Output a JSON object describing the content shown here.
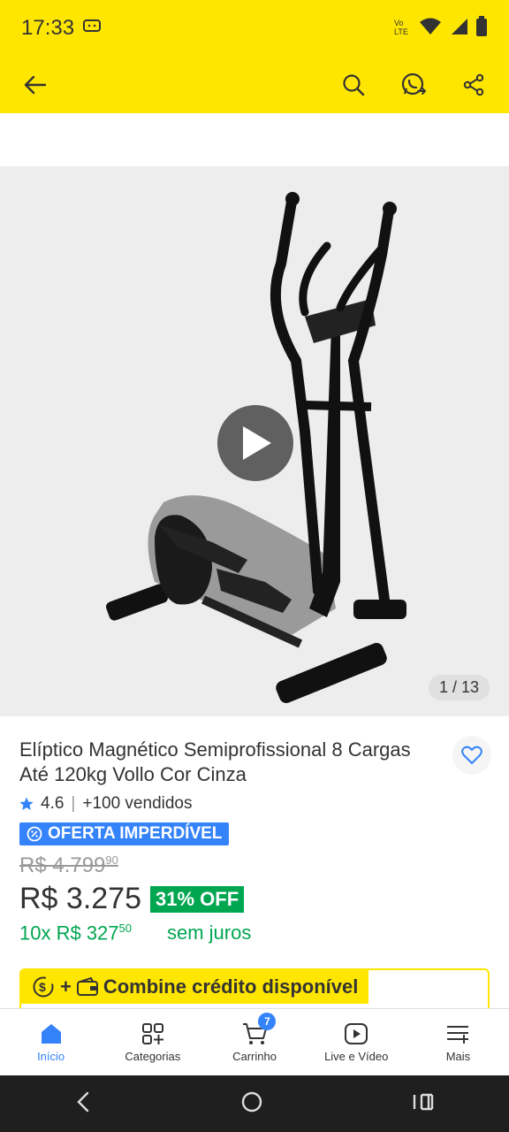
{
  "status_bar": {
    "time": "17:33"
  },
  "gallery": {
    "counter": "1 / 13"
  },
  "product": {
    "title": "Elíptico Magnético Semiprofissional 8 Cargas Até 120kg Vollo Cor Cinza",
    "rating": "4.6",
    "sold": "+100 vendidos",
    "badge": "OFERTA IMPERDÍVEL",
    "old_price": "R$ 4.799",
    "old_price_cents": "90",
    "price": "R$ 3.275",
    "discount": "31% OFF",
    "installments": "10x R$ 327",
    "installments_cents": "50",
    "installments_note": "sem juros"
  },
  "credit_banner": {
    "label": "Combine crédito disponível"
  },
  "bottom_nav": {
    "items": [
      {
        "label": "Início"
      },
      {
        "label": "Categorias"
      },
      {
        "label": "Carrinho"
      },
      {
        "label": "Live e Vídeo"
      },
      {
        "label": "Mais"
      }
    ],
    "cart_count": "7"
  },
  "colors": {
    "brand_yellow": "#FFE600",
    "accent_blue": "#3483FA",
    "success_green": "#00A650"
  }
}
